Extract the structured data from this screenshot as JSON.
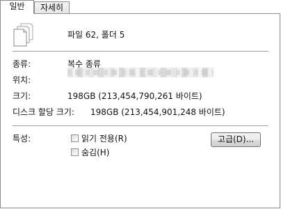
{
  "tabs": [
    {
      "label": "일반",
      "selected": true
    },
    {
      "label": "자세히",
      "selected": false
    }
  ],
  "summary": {
    "icon": "files-stack-icon",
    "text": "파일 62, 폴더 5"
  },
  "type": {
    "label": "종류:",
    "value": "복수 종류"
  },
  "location": {
    "label": "위치:"
  },
  "size": {
    "label": "크기:",
    "value": "198GB (213,454,790,261 바이트)"
  },
  "size_on_disk": {
    "label": "디스크 할당 크기:",
    "value": "198GB (213,454,901,248 바이트)"
  },
  "attributes": {
    "label": "특성:",
    "read_only": {
      "label": "읽기 전용(R)",
      "checked": false
    },
    "hidden": {
      "label": "숨김(H)",
      "checked": false
    },
    "advanced_button": "고급(D)..."
  }
}
